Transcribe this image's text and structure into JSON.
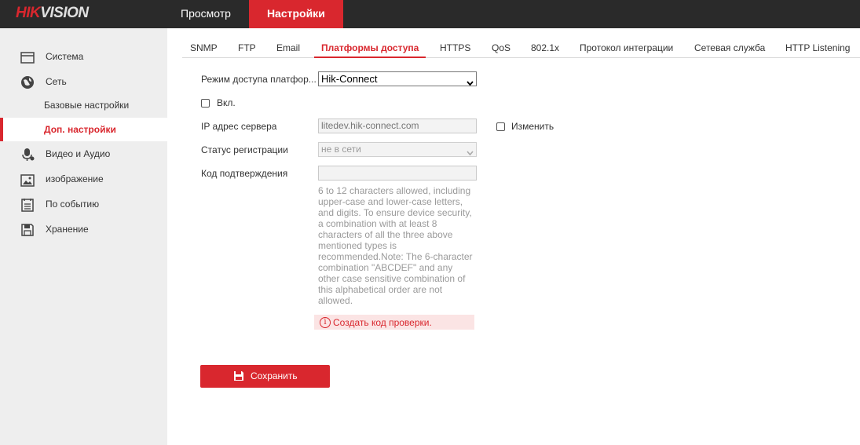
{
  "brand": {
    "logo_hik": "HIK",
    "logo_vision": "VISION"
  },
  "top_nav": {
    "view_label": "Просмотр",
    "settings_label": "Настройки"
  },
  "sidebar": {
    "items": [
      {
        "label": "Система",
        "icon": "monitor-icon"
      },
      {
        "label": "Сеть",
        "icon": "globe-icon"
      },
      {
        "label": "Базовые настройки"
      },
      {
        "label": "Доп. настройки",
        "active": true
      },
      {
        "label": "Видео и Аудио",
        "icon": "microphone-icon"
      },
      {
        "label": "изображение",
        "icon": "image-icon"
      },
      {
        "label": "По событию",
        "icon": "event-list-icon"
      },
      {
        "label": "Хранение",
        "icon": "storage-icon"
      }
    ]
  },
  "sub_tabs": [
    {
      "label": "SNMP"
    },
    {
      "label": "FTP"
    },
    {
      "label": "Email"
    },
    {
      "label": "Платформы доступа",
      "active": true
    },
    {
      "label": "HTTPS"
    },
    {
      "label": "QoS"
    },
    {
      "label": "802.1x"
    },
    {
      "label": "Протокол интеграции"
    },
    {
      "label": "Сетевая служба"
    },
    {
      "label": "HTTP Listening"
    }
  ],
  "form": {
    "access_mode_label": "Режим доступа платфор...",
    "access_mode_value": "Hik-Connect",
    "enable_label": "Вкл.",
    "server_ip_label": "IP адрес сервера",
    "server_ip_value": "litedev.hik-connect.com",
    "change_label": "Изменить",
    "reg_status_label": "Статус регистрации",
    "reg_status_value": "не в сети",
    "verify_code_label": "Код подтверждения",
    "verify_code_value": "",
    "hint": "6 to 12 characters allowed, including upper-case and lower-case letters, and digits. To ensure device security, a combination with at least 8 characters of all the three above mentioned types is recommended.Note: The 6-character combination \"ABCDEF\" and any other case sensitive combination of this alphabetical order are not allowed.",
    "warning": "Создать код проверки.",
    "save_label": "Сохранить"
  },
  "colors": {
    "accent": "#d9272e",
    "topbar": "#2a2a2a",
    "sidebar": "#eeeeee"
  }
}
